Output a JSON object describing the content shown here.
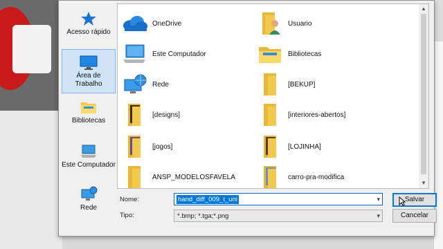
{
  "sidebar": {
    "items": [
      {
        "label": "Acesso rápido",
        "icon": "star-icon"
      },
      {
        "label": "Área de Trabalho",
        "icon": "desktop-icon"
      },
      {
        "label": "Bibliotecas",
        "icon": "library-folder-icon"
      },
      {
        "label": "Este Computador",
        "icon": "computer-icon"
      },
      {
        "label": "Rede",
        "icon": "network-icon"
      }
    ],
    "selected": "Área de Trabalho"
  },
  "files": [
    {
      "name": "OneDrive",
      "icon": "cloud-icon"
    },
    {
      "name": "Usuario",
      "icon": "user-folder-icon"
    },
    {
      "name": "Este Computador",
      "icon": "computer-icon"
    },
    {
      "name": "Bibliotecas",
      "icon": "library-folder-icon"
    },
    {
      "name": "Rede",
      "icon": "network-icon"
    },
    {
      "name": "[BEKUP]",
      "icon": "folder-icon"
    },
    {
      "name": "[designs]",
      "icon": "folder-icon"
    },
    {
      "name": "[interiores-abertos]",
      "icon": "folder-icon"
    },
    {
      "name": "[jogos]",
      "icon": "folder-icon"
    },
    {
      "name": "[LOJINHA]",
      "icon": "folder-icon"
    },
    {
      "name": "ANSP_MODELOSFAVELA",
      "icon": "folder-icon"
    },
    {
      "name": "carro-pra-modifica",
      "icon": "folder-icon"
    }
  ],
  "form": {
    "name_label": "Nome:",
    "name_value": "hand_diff_009_t_uni",
    "type_label": "Tipo:",
    "type_value": "*.bmp; *.tga;*.png"
  },
  "buttons": {
    "save": "Salvar",
    "cancel": "Cancelar"
  },
  "colors": {
    "selection": "#0078d7",
    "sidebar_selected": "#cfe4f7",
    "folder": "#f3c94d"
  }
}
